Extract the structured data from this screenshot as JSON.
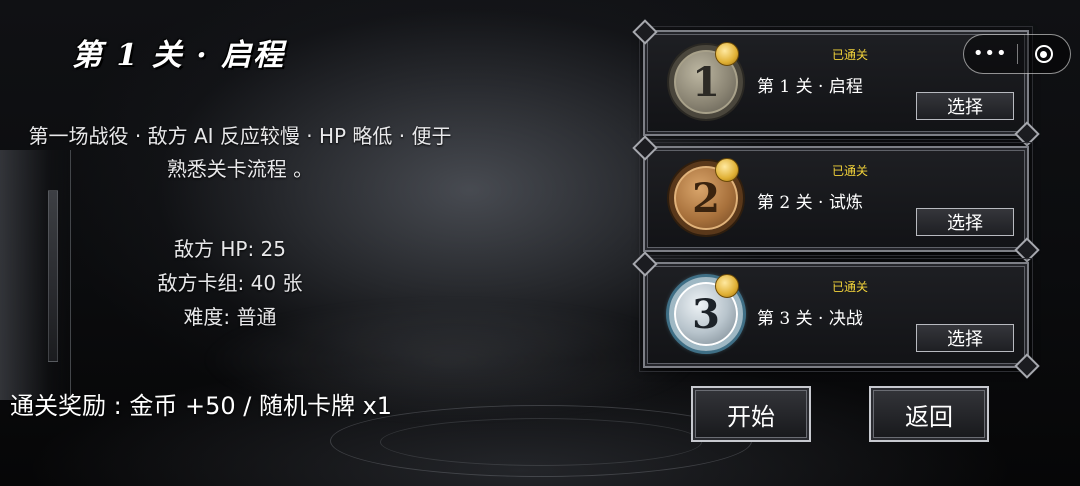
{
  "level": {
    "title": "第 1 关 · 启程",
    "description": "第一场战役 · 敌方 AI 反应较慢 · HP 略低 · 便于熟悉关卡流程 。",
    "stats": {
      "enemy_hp": "敌方 HP: 25",
      "enemy_deck": "敌方卡组: 40 张",
      "difficulty": "难度: 普通"
    },
    "reward": "通关奖励 : 金币 +50 / 随机卡牌 x1"
  },
  "stage_list": [
    {
      "badge": "1",
      "status": "已通关",
      "name": "第 1 关 · 启程",
      "select_label": "选择"
    },
    {
      "badge": "2",
      "status": "已通关",
      "name": "第 2 关 · 试炼",
      "select_label": "选择"
    },
    {
      "badge": "3",
      "status": "已通关",
      "name": "第 3 关 · 决战",
      "select_label": "选择"
    }
  ],
  "actions": {
    "start_label": "开始",
    "back_label": "返回"
  },
  "capsule": {
    "more_label": "•••",
    "more_icon": "more-dots-icon",
    "close_icon": "target-icon"
  },
  "colors": {
    "status_text": "#f1d23a",
    "text": "#ffffff",
    "frame": "#7d7f86"
  }
}
